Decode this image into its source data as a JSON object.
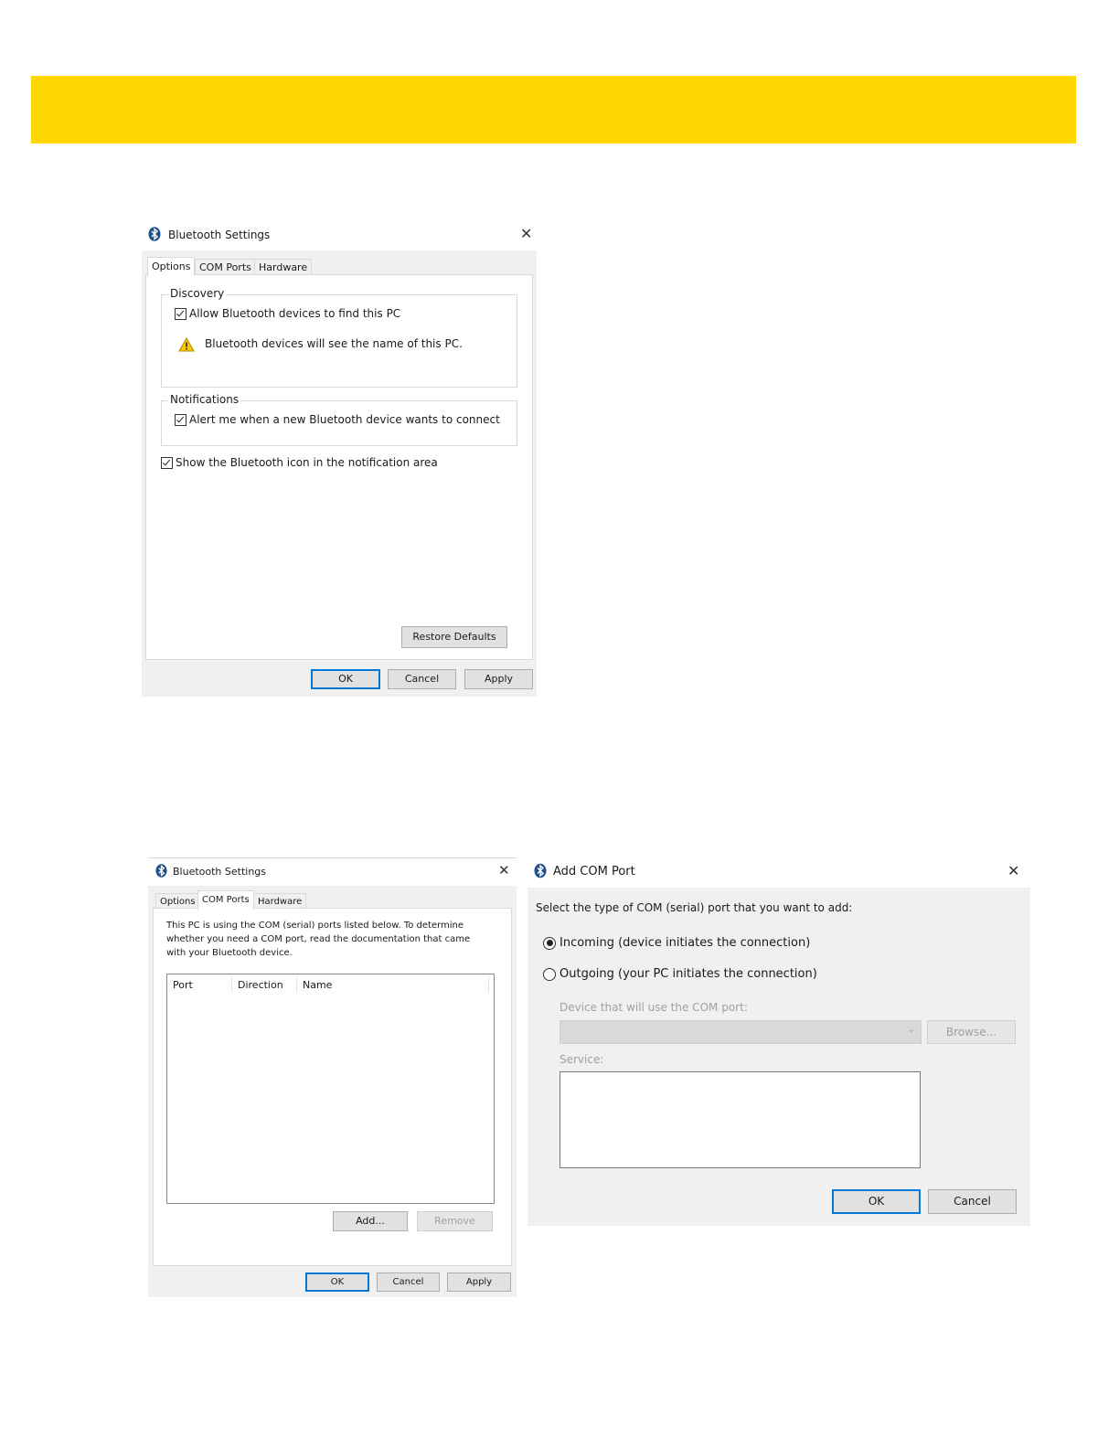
{
  "colors": {
    "banner": "#fed700",
    "accent": "#0078d7",
    "dialog_bg": "#f0f0f0"
  },
  "dialog1": {
    "title": "Bluetooth Settings",
    "icon": "bluetooth-icon",
    "tabs": [
      "Options",
      "COM Ports",
      "Hardware"
    ],
    "active_tab": "Options",
    "discovery": {
      "legend": "Discovery",
      "allow_label": "Allow Bluetooth devices to find this PC",
      "warning": "Bluetooth devices will see the name of this PC."
    },
    "notifications": {
      "legend": "Notifications",
      "alert_label": "Alert me when a new Bluetooth device wants to connect"
    },
    "show_icon_label": "Show the Bluetooth icon in the notification area",
    "restore_defaults": "Restore Defaults",
    "ok": "OK",
    "cancel": "Cancel",
    "apply": "Apply"
  },
  "dialog2": {
    "title": "Bluetooth Settings",
    "icon": "bluetooth-icon",
    "tabs": [
      "Options",
      "COM Ports",
      "Hardware"
    ],
    "active_tab": "COM Ports",
    "description": [
      "This PC is using the COM (serial) ports listed below. To determine",
      "whether you need a COM port, read the documentation that came",
      "with your Bluetooth device."
    ],
    "columns": [
      "Port",
      "Direction",
      "Name"
    ],
    "add": "Add...",
    "remove": "Remove",
    "ok": "OK",
    "cancel": "Cancel",
    "apply": "Apply"
  },
  "dialog3": {
    "title": "Add COM Port",
    "icon": "bluetooth-icon",
    "prompt": "Select the type of COM (serial) port that you want to add:",
    "incoming": "Incoming (device initiates the connection)",
    "outgoing": "Outgoing (your PC initiates the connection)",
    "device_label": "Device that will use the COM port:",
    "browse": "Browse...",
    "service_label": "Service:",
    "ok": "OK",
    "cancel": "Cancel"
  }
}
